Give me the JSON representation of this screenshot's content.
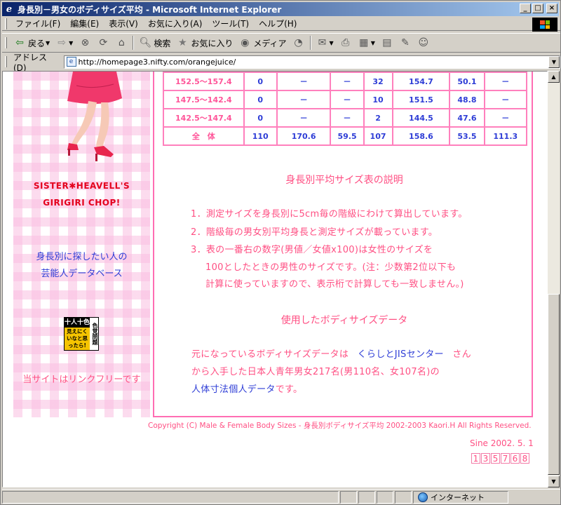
{
  "window": {
    "title": "身長別－男女のボディサイズ平均 - Microsoft Internet Explorer",
    "minimize": "_",
    "maximize": "□",
    "close": "×"
  },
  "menubar": {
    "items": [
      "ファイル(F)",
      "編集(E)",
      "表示(V)",
      "お気に入り(A)",
      "ツール(T)",
      "ヘルプ(H)"
    ]
  },
  "toolbar": {
    "back_label": "戻る",
    "search_label": "検索",
    "favorites_label": "お気に入り",
    "media_label": "メディア"
  },
  "address": {
    "label": "アドレス(D)",
    "url": "http://homepage3.nifty.com/orangejuice/"
  },
  "sidebar": {
    "site_name_1": "SISTER✱HEAVELL'S",
    "site_name_2": "GIRIGIRI CHOP!",
    "db_link_1": "身長別に探したい人の",
    "db_link_2": "芸能人データベース",
    "badge_top": "十人十色",
    "badge_main": "見えにくいなと思ったら!",
    "badge_side": "色覚問題",
    "link_free": "当サイトはリンクフリーです"
  },
  "table": {
    "rows": [
      [
        "152.5～157.4",
        "0",
        "－",
        "－",
        "32",
        "154.7",
        "50.1",
        "－"
      ],
      [
        "147.5～142.4",
        "0",
        "－",
        "－",
        "10",
        "151.5",
        "48.8",
        "－"
      ],
      [
        "142.5～147.4",
        "0",
        "－",
        "－",
        "2",
        "144.5",
        "47.6",
        "－"
      ],
      [
        "全　体",
        "110",
        "170.6",
        "59.5",
        "107",
        "158.6",
        "53.5",
        "111.3"
      ]
    ]
  },
  "explanation": {
    "heading": "身長別平均サイズ表の説明",
    "line1": "1．測定サイズを身長別に5cm毎の階級にわけて算出しています。",
    "line2": "2．階級毎の男女別平均身長と測定サイズが載っています。",
    "line3": "3．表の一番右の数字(男値／女値x100)は女性のサイズを",
    "line4": "100としたときの男性のサイズです。(注：少数第2位以下も",
    "line5": "計算に使っていますので、表示桁で計算しても一致しません。)"
  },
  "source": {
    "heading": "使用したボディサイズデータ",
    "line1_a": "元になっているボディサイズデータは",
    "line1_link": "くらしとJISセンター",
    "line1_b": "さん",
    "line2": "から入手した日本人青年男女217名(男110名、女107名)の",
    "line3_link": "人体寸法個人データ",
    "line3_b": "です。"
  },
  "footer": {
    "copyright_a": "Copyright (C) Male & Female Body Sizes - ",
    "copyright_b": "身長別ボディサイズ平均",
    "copyright_c": " 2002-2003 Kaori.H All Rights Reserved.",
    "since": "Sine 2002. 5. 1",
    "counter": [
      "1",
      "3",
      "5",
      "7",
      "6",
      "8"
    ]
  },
  "status": {
    "zone": "インターネット"
  },
  "colors": {
    "pink_text": "#ff4f83",
    "blue_text": "#2e3dd6",
    "border_pink": "#ff80bd",
    "red_title": "#e4001d"
  }
}
